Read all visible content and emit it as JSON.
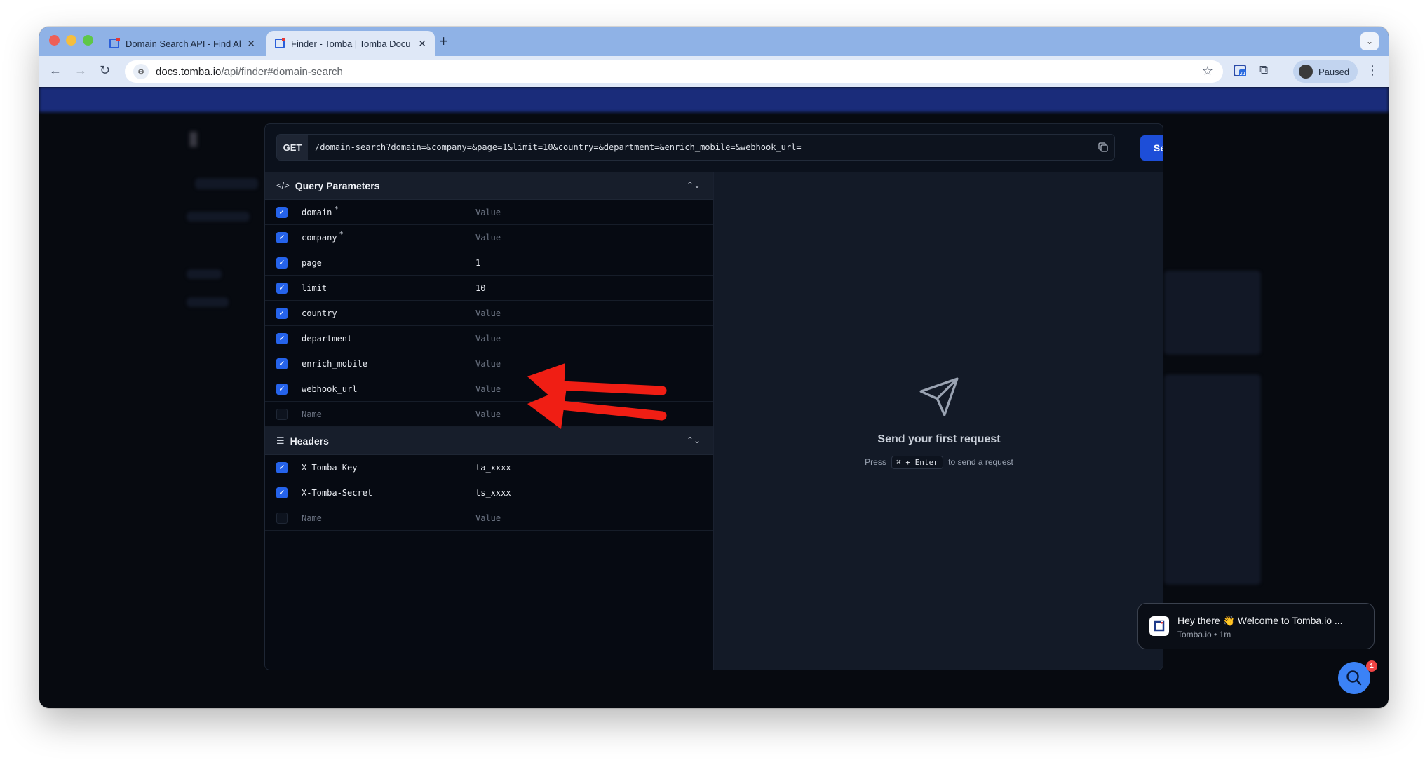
{
  "browser": {
    "tabs": [
      {
        "title": "Domain Search API - Find All",
        "active": false
      },
      {
        "title": "Finder - Tomba | Tomba Docu",
        "active": true
      }
    ],
    "url_host": "docs.tomba.io",
    "url_path": "/api/finder#domain-search",
    "profile_label": "Paused",
    "calendar_badge": "21"
  },
  "request": {
    "method": "GET",
    "path": "/domain-search?domain=&company=&page=1&limit=10&country=&department=&enrich_mobile=&webhook_url=",
    "send_label": "Send"
  },
  "query_params": {
    "title": "Query Parameters",
    "rows": [
      {
        "name": "domain",
        "required": true,
        "value": "",
        "placeholder": "Value"
      },
      {
        "name": "company",
        "required": true,
        "value": "",
        "placeholder": "Value"
      },
      {
        "name": "page",
        "required": false,
        "value": "1",
        "placeholder": "Value"
      },
      {
        "name": "limit",
        "required": false,
        "value": "10",
        "placeholder": "Value"
      },
      {
        "name": "country",
        "required": false,
        "value": "",
        "placeholder": "Value"
      },
      {
        "name": "department",
        "required": false,
        "value": "",
        "placeholder": "Value"
      },
      {
        "name": "enrich_mobile",
        "required": false,
        "value": "",
        "placeholder": "Value"
      },
      {
        "name": "webhook_url",
        "required": false,
        "value": "",
        "placeholder": "Value"
      }
    ],
    "new_row": {
      "name_placeholder": "Name",
      "value_placeholder": "Value"
    }
  },
  "headers": {
    "title": "Headers",
    "rows": [
      {
        "name": "X-Tomba-Key",
        "value": "ta_xxxx"
      },
      {
        "name": "X-Tomba-Secret",
        "value": "ts_xxxx"
      }
    ],
    "new_row": {
      "name_placeholder": "Name",
      "value_placeholder": "Value"
    }
  },
  "response": {
    "empty_title": "Send your first request",
    "hint_prefix": "Press",
    "hint_keys": "⌘ + Enter",
    "hint_suffix": "to send a request"
  },
  "chat": {
    "message": "Hey there 👋 Welcome to Tomba.io ...",
    "meta": "Tomba.io • 1m",
    "badge_count": "1"
  },
  "colors": {
    "accent": "#1d4ed8",
    "checkbox": "#2563eb",
    "annotation": "#f01e14"
  }
}
